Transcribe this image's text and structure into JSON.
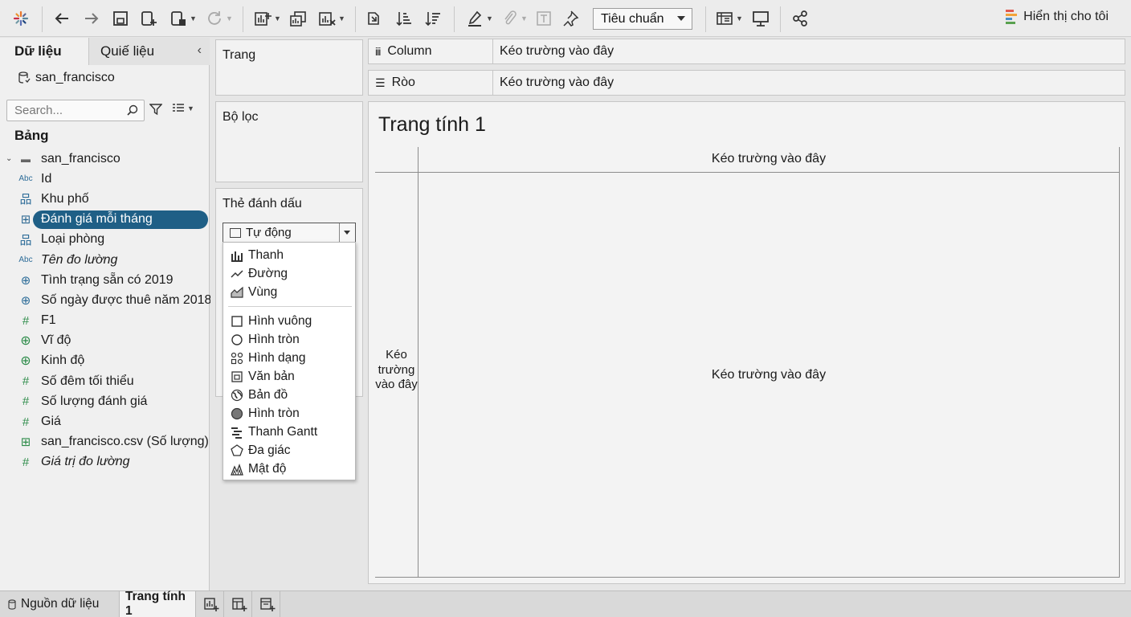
{
  "toolbar": {
    "items": [
      {
        "name": "tableau-logo-icon",
        "glyph": "✻"
      },
      {
        "name": "undo-icon",
        "glyph": "←"
      },
      {
        "name": "redo-icon",
        "glyph": "→"
      },
      {
        "name": "save-icon",
        "glyph": ""
      },
      {
        "name": "new-datasource-icon",
        "glyph": ""
      },
      {
        "name": "pause-updates-icon",
        "glyph": ""
      },
      {
        "name": "refresh-icon",
        "glyph": "↻"
      },
      {
        "name": "new-worksheet-icon",
        "glyph": ""
      },
      {
        "name": "duplicate-sheet-icon",
        "glyph": ""
      },
      {
        "name": "clear-sheet-icon",
        "glyph": ""
      },
      {
        "name": "swap-rows-columns-icon",
        "glyph": ""
      },
      {
        "name": "sort-ascending-icon",
        "glyph": ""
      },
      {
        "name": "sort-descending-icon",
        "glyph": ""
      },
      {
        "name": "highlight-icon",
        "glyph": ""
      },
      {
        "name": "group-members-icon",
        "glyph": ""
      },
      {
        "name": "show-mark-labels-icon",
        "glyph": ""
      },
      {
        "name": "pin-icon",
        "glyph": ""
      },
      {
        "name": "show-cards-icon",
        "glyph": ""
      },
      {
        "name": "presentation-mode-icon",
        "glyph": ""
      },
      {
        "name": "share-icon",
        "glyph": ""
      }
    ],
    "fit_select": "Tiêu chuẩn",
    "show_me": "Hiển thị cho tôi",
    "show_me_colors": [
      "#e05a4f",
      "#f2a33a",
      "#4a90c8",
      "#59a14f"
    ]
  },
  "datapane": {
    "tab_data": "Dữ liệu",
    "tab_analytics": "Quiế liệu",
    "collapse": "‹",
    "datasource": "san_francisco",
    "search_placeholder": "Search...",
    "section": "Bảng",
    "fields": [
      {
        "label": "san_francisco",
        "icon": "table-icon",
        "glyph": "▬",
        "type": "table"
      },
      {
        "label": "Id",
        "icon": "string-icon",
        "glyph": "Abc",
        "type": "dim"
      },
      {
        "label": "Khu phố",
        "icon": "hierarchy-icon",
        "glyph": "品",
        "type": "dim"
      },
      {
        "label": "Đánh giá mỗi tháng",
        "icon": "crosstab-icon",
        "glyph": "⊞",
        "type": "selected"
      },
      {
        "label": "Loại phòng",
        "icon": "hierarchy-icon",
        "glyph": "品",
        "type": "dim"
      },
      {
        "label": "Tên đo lường",
        "icon": "string-icon",
        "glyph": "Abc",
        "type": "italic"
      },
      {
        "label": "Tình trạng sẵn có 2019",
        "icon": "globe-icon",
        "glyph": "⊕",
        "type": "dim"
      },
      {
        "label": "Số ngày được thuê năm 2018",
        "icon": "globe-link-icon",
        "glyph": "⊕",
        "type": "dim"
      },
      {
        "label": "F1",
        "icon": "number-icon",
        "glyph": "#",
        "type": "measure"
      },
      {
        "label": "Vĩ độ",
        "icon": "globe-icon",
        "glyph": "⊕",
        "type": "geo"
      },
      {
        "label": "Kinh độ",
        "icon": "globe-icon",
        "glyph": "⊕",
        "type": "geo"
      },
      {
        "label": "Số đêm tối thiểu",
        "icon": "number-icon",
        "glyph": "#",
        "type": "measure"
      },
      {
        "label": "Số lượng đánh giá",
        "icon": "number-icon",
        "glyph": "#",
        "type": "measure"
      },
      {
        "label": "Giá",
        "icon": "number-icon",
        "glyph": "#",
        "type": "measure"
      },
      {
        "label": "san_francisco.csv (Số lượng)",
        "icon": "count-table-icon",
        "glyph": "⊞",
        "type": "measure"
      },
      {
        "label": "Giá trị đo lường",
        "icon": "number-icon",
        "glyph": "#",
        "type": "measure-italic"
      }
    ]
  },
  "cards": {
    "pages": "Trang",
    "filters": "Bộ lọc",
    "marks": "Thẻ đánh dấu",
    "mark_type": "Tự động"
  },
  "mark_menu": [
    {
      "label": "Thanh",
      "icon": "bar-icon"
    },
    {
      "label": "Đường",
      "icon": "line-icon"
    },
    {
      "label": "Vùng",
      "icon": "area-icon"
    },
    {
      "label": "Hình vuông",
      "icon": "square-icon"
    },
    {
      "label": "Hình tròn",
      "icon": "circle-icon"
    },
    {
      "label": "Hình dạng",
      "icon": "shape-icon"
    },
    {
      "label": "Văn bản",
      "icon": "text-icon"
    },
    {
      "label": "Bản đồ",
      "icon": "map-icon"
    },
    {
      "label": "Hình tròn",
      "icon": "pie-icon"
    },
    {
      "label": "Thanh Gantt",
      "icon": "gantt-icon"
    },
    {
      "label": "Đa giác",
      "icon": "polygon-icon"
    },
    {
      "label": "Mật độ",
      "icon": "density-icon"
    }
  ],
  "shelves": {
    "columns_label": "Column",
    "columns_prefix": "iii",
    "rows_label": "Ròo",
    "rows_prefix": "☰",
    "columns_drop": "Kéo trường vào đây",
    "rows_drop": "Kéo trường vào đây"
  },
  "canvas": {
    "title": "Trang tính 1",
    "col_drop": "Kéo trường vào đây",
    "row_drop": "Kéo trường vào đây",
    "center_drop": "Kéo trường vào đây"
  },
  "bottom": {
    "datasource_tab": "Nguồn dữ liệu",
    "sheet_tab": "Trang tính 1"
  }
}
